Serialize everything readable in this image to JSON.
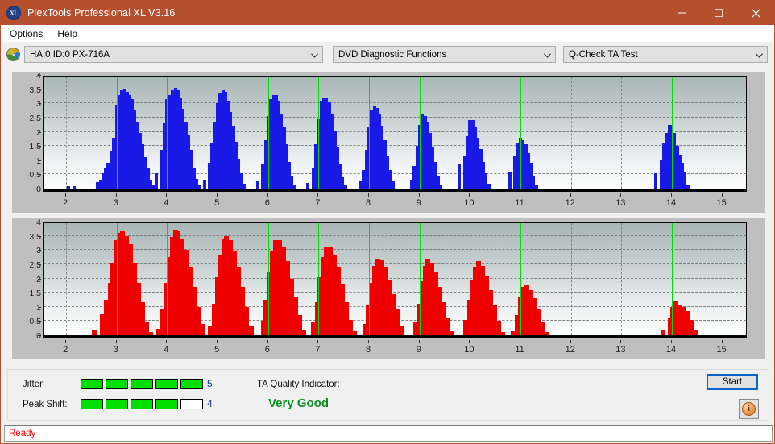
{
  "window": {
    "title": "PlexTools Professional XL V3.16",
    "app_icon": "xl-disc-icon",
    "minimize_label": "minimize-icon",
    "maximize_label": "maximize-icon",
    "close_label": "close-icon",
    "titlebar_color": "#b5502f"
  },
  "menu": {
    "items": [
      {
        "label": "Options"
      },
      {
        "label": "Help"
      }
    ]
  },
  "toolbar": {
    "drive_icon": "disc-icon",
    "drive_select": {
      "value": "HA:0 ID:0  PX-716A",
      "options": [
        "HA:0 ID:0  PX-716A"
      ]
    },
    "function_select": {
      "value": "DVD Diagnostic Functions",
      "options": [
        "DVD Diagnostic Functions"
      ]
    },
    "test_select": {
      "value": "Q-Check TA Test",
      "options": [
        "Q-Check TA Test"
      ]
    }
  },
  "results": {
    "jitter_label": "Jitter:",
    "jitter_value": "5",
    "jitter_segments": [
      true,
      true,
      true,
      true,
      true
    ],
    "peak_shift_label": "Peak Shift:",
    "peak_shift_value": "4",
    "peak_shift_segments": [
      true,
      true,
      true,
      true,
      false
    ],
    "quality_label": "TA Quality Indicator:",
    "quality_value": "Very Good",
    "quality_color": "#0a8f20",
    "start_button": "Start",
    "info_button": "info-icon"
  },
  "status": {
    "text": "Ready",
    "color": "#ff0000"
  },
  "chart_data": [
    {
      "type": "bar",
      "name": "jitter-histogram",
      "title": "",
      "xlabel": "",
      "ylabel": "",
      "color": "#1a1ae6",
      "xlim": [
        1.55,
        15.5
      ],
      "ylim": [
        0,
        4
      ],
      "yticks": [
        0,
        0.5,
        1,
        1.5,
        2,
        2.5,
        3,
        3.5,
        4
      ],
      "ytick_labels": [
        "0",
        "0.5",
        "1",
        "1.5",
        "2",
        "2.5",
        "3",
        "3.5",
        "4"
      ],
      "xticks": [
        2,
        3,
        4,
        5,
        6,
        7,
        8,
        9,
        10,
        11,
        12,
        13,
        14,
        15
      ],
      "xtick_labels": [
        "2",
        "3",
        "4",
        "5",
        "6",
        "7",
        "8",
        "9",
        "10",
        "11",
        "12",
        "13",
        "14",
        "15"
      ],
      "grid": true,
      "markers": [
        3,
        4,
        5,
        6,
        7,
        8,
        9,
        10,
        11,
        14
      ],
      "marker_color": "#00e000",
      "bar_step": 0.105,
      "points": [
        [
          2.05,
          0.09
        ],
        [
          2.16,
          0.09
        ],
        [
          2.62,
          0.22
        ],
        [
          2.73,
          0.55
        ],
        [
          2.83,
          0.9
        ],
        [
          2.89,
          1.3
        ],
        [
          2.94,
          1.78
        ],
        [
          3.0,
          2.3
        ],
        [
          3.05,
          2.47
        ],
        [
          3.1,
          2.8
        ],
        [
          2.68,
          0.3
        ],
        [
          2.78,
          0.72
        ],
        [
          3.0,
          2.95
        ],
        [
          3.05,
          3.3
        ],
        [
          3.1,
          3.45
        ],
        [
          3.16,
          3.5
        ],
        [
          3.21,
          3.4
        ],
        [
          3.26,
          3.3
        ],
        [
          3.31,
          3.15
        ],
        [
          3.36,
          2.75
        ],
        [
          3.42,
          2.35
        ],
        [
          3.47,
          1.95
        ],
        [
          3.52,
          1.55
        ],
        [
          3.57,
          1.1
        ],
        [
          3.63,
          0.7
        ],
        [
          3.68,
          0.3
        ],
        [
          3.73,
          0.12
        ],
        [
          4.0,
          3.15
        ],
        [
          3.79,
          0.55
        ],
        [
          3.89,
          1.35
        ],
        [
          3.95,
          2.3
        ],
        [
          4.05,
          3.3
        ],
        [
          4.1,
          3.45
        ],
        [
          4.16,
          3.55
        ],
        [
          4.21,
          3.45
        ],
        [
          4.26,
          3.2
        ],
        [
          4.31,
          2.8
        ],
        [
          4.37,
          2.35
        ],
        [
          4.42,
          1.9
        ],
        [
          4.47,
          1.35
        ],
        [
          4.53,
          0.75
        ],
        [
          4.58,
          0.35
        ],
        [
          4.63,
          0.12
        ],
        [
          4.74,
          0.3
        ],
        [
          4.84,
          0.9
        ],
        [
          4.89,
          1.6
        ],
        [
          4.95,
          2.35
        ],
        [
          5.0,
          3.0
        ],
        [
          5.05,
          3.35
        ],
        [
          5.11,
          3.45
        ],
        [
          5.16,
          3.4
        ],
        [
          5.21,
          3.1
        ],
        [
          5.26,
          2.7
        ],
        [
          5.32,
          2.2
        ],
        [
          5.37,
          1.65
        ],
        [
          5.42,
          1.05
        ],
        [
          5.47,
          0.55
        ],
        [
          5.53,
          0.18
        ],
        [
          5.79,
          0.25
        ],
        [
          5.89,
          0.85
        ],
        [
          5.95,
          1.7
        ],
        [
          6.0,
          2.55
        ],
        [
          6.05,
          3.15
        ],
        [
          6.11,
          3.3
        ],
        [
          6.16,
          3.3
        ],
        [
          6.21,
          3.1
        ],
        [
          6.26,
          2.65
        ],
        [
          6.32,
          2.15
        ],
        [
          6.37,
          1.55
        ],
        [
          6.42,
          0.95
        ],
        [
          6.47,
          0.45
        ],
        [
          6.53,
          0.15
        ],
        [
          6.79,
          0.2
        ],
        [
          6.89,
          0.75
        ],
        [
          6.95,
          1.55
        ],
        [
          7.0,
          2.45
        ],
        [
          7.05,
          3.1
        ],
        [
          7.11,
          3.2
        ],
        [
          7.16,
          3.2
        ],
        [
          7.21,
          3.05
        ],
        [
          7.26,
          2.6
        ],
        [
          7.32,
          2.05
        ],
        [
          7.37,
          1.45
        ],
        [
          7.42,
          0.85
        ],
        [
          7.47,
          0.4
        ],
        [
          7.53,
          0.12
        ],
        [
          7.84,
          0.25
        ],
        [
          7.89,
          0.65
        ],
        [
          7.95,
          1.35
        ],
        [
          8.0,
          2.15
        ],
        [
          8.05,
          2.75
        ],
        [
          8.11,
          2.9
        ],
        [
          8.16,
          2.85
        ],
        [
          8.21,
          2.6
        ],
        [
          8.26,
          2.2
        ],
        [
          8.32,
          1.7
        ],
        [
          8.37,
          1.15
        ],
        [
          8.42,
          0.65
        ],
        [
          8.47,
          0.25
        ],
        [
          8.84,
          0.3
        ],
        [
          8.89,
          0.8
        ],
        [
          8.95,
          1.5
        ],
        [
          9.0,
          2.25
        ],
        [
          9.05,
          2.6
        ],
        [
          9.11,
          2.55
        ],
        [
          9.16,
          2.35
        ],
        [
          9.21,
          1.95
        ],
        [
          9.26,
          1.45
        ],
        [
          9.32,
          0.95
        ],
        [
          9.37,
          0.45
        ],
        [
          9.42,
          0.15
        ],
        [
          9.79,
          0.85
        ],
        [
          9.89,
          1.15
        ],
        [
          9.95,
          1.85
        ],
        [
          10.0,
          2.4
        ],
        [
          10.05,
          2.4
        ],
        [
          10.11,
          2.15
        ],
        [
          10.16,
          1.8
        ],
        [
          10.21,
          1.4
        ],
        [
          10.26,
          0.95
        ],
        [
          10.32,
          0.55
        ],
        [
          10.37,
          0.18
        ],
        [
          10.79,
          0.6
        ],
        [
          10.89,
          1.15
        ],
        [
          10.95,
          1.6
        ],
        [
          11.0,
          1.8
        ],
        [
          11.05,
          1.7
        ],
        [
          11.11,
          1.55
        ],
        [
          11.16,
          1.25
        ],
        [
          11.21,
          0.9
        ],
        [
          11.26,
          0.45
        ],
        [
          11.32,
          0.12
        ],
        [
          13.68,
          0.55
        ],
        [
          13.79,
          1.0
        ],
        [
          13.84,
          1.6
        ],
        [
          13.89,
          1.95
        ],
        [
          13.95,
          2.25
        ],
        [
          14.0,
          2.25
        ],
        [
          14.05,
          1.95
        ],
        [
          14.11,
          1.5
        ],
        [
          14.16,
          1.2
        ],
        [
          14.21,
          0.9
        ],
        [
          14.26,
          0.6
        ],
        [
          14.32,
          0.12
        ]
      ]
    },
    {
      "type": "bar",
      "name": "peak-shift-histogram",
      "title": "",
      "xlabel": "",
      "ylabel": "",
      "color": "#ee0000",
      "xlim": [
        1.55,
        15.5
      ],
      "ylim": [
        0,
        4
      ],
      "yticks": [
        0,
        0.5,
        1,
        1.5,
        2,
        2.5,
        3,
        3.5,
        4
      ],
      "ytick_labels": [
        "0",
        "0.5",
        "1",
        "1.5",
        "2",
        "2.5",
        "3",
        "3.5",
        "4"
      ],
      "xticks": [
        2,
        3,
        4,
        5,
        6,
        7,
        8,
        9,
        10,
        11,
        12,
        13,
        14,
        15
      ],
      "xtick_labels": [
        "2",
        "3",
        "4",
        "5",
        "6",
        "7",
        "8",
        "9",
        "10",
        "11",
        "12",
        "13",
        "14",
        "15"
      ],
      "grid": true,
      "markers": [
        3,
        4,
        5,
        6,
        7,
        8,
        9,
        10,
        11,
        14
      ],
      "marker_color": "#00e000",
      "bar_step": 0.155,
      "points": [
        [
          2.55,
          0.18
        ],
        [
          2.71,
          0.75
        ],
        [
          2.79,
          1.25
        ],
        [
          2.87,
          1.85
        ],
        [
          2.93,
          2.55
        ],
        [
          3.0,
          3.35
        ],
        [
          3.06,
          3.6
        ],
        [
          3.12,
          3.65
        ],
        [
          3.2,
          3.5
        ],
        [
          3.28,
          3.2
        ],
        [
          3.36,
          2.55
        ],
        [
          3.44,
          1.85
        ],
        [
          3.52,
          1.15
        ],
        [
          3.6,
          0.45
        ],
        [
          3.68,
          0.12
        ],
        [
          3.84,
          0.22
        ],
        [
          3.92,
          0.95
        ],
        [
          3.98,
          1.85
        ],
        [
          4.04,
          2.75
        ],
        [
          4.1,
          3.45
        ],
        [
          4.16,
          3.7
        ],
        [
          4.22,
          3.65
        ],
        [
          4.3,
          3.4
        ],
        [
          4.38,
          3.0
        ],
        [
          4.46,
          2.4
        ],
        [
          4.54,
          1.7
        ],
        [
          4.62,
          1.0
        ],
        [
          4.7,
          0.4
        ],
        [
          4.86,
          0.35
        ],
        [
          4.93,
          1.1
        ],
        [
          5.0,
          2.05
        ],
        [
          5.06,
          2.85
        ],
        [
          5.12,
          3.4
        ],
        [
          5.18,
          3.5
        ],
        [
          5.26,
          3.35
        ],
        [
          5.34,
          2.95
        ],
        [
          5.42,
          2.4
        ],
        [
          5.5,
          1.7
        ],
        [
          5.58,
          1.0
        ],
        [
          5.66,
          0.35
        ],
        [
          5.9,
          0.5
        ],
        [
          5.96,
          1.25
        ],
        [
          6.02,
          2.2
        ],
        [
          6.08,
          2.95
        ],
        [
          6.14,
          3.35
        ],
        [
          6.22,
          3.35
        ],
        [
          6.3,
          3.1
        ],
        [
          6.38,
          2.6
        ],
        [
          6.46,
          2.0
        ],
        [
          6.54,
          1.35
        ],
        [
          6.62,
          0.7
        ],
        [
          6.7,
          0.2
        ],
        [
          6.9,
          0.45
        ],
        [
          6.97,
          1.15
        ],
        [
          7.03,
          2.05
        ],
        [
          7.09,
          2.75
        ],
        [
          7.15,
          3.1
        ],
        [
          7.23,
          3.1
        ],
        [
          7.31,
          2.85
        ],
        [
          7.39,
          2.4
        ],
        [
          7.47,
          1.8
        ],
        [
          7.55,
          1.15
        ],
        [
          7.63,
          0.55
        ],
        [
          7.71,
          0.15
        ],
        [
          7.92,
          0.4
        ],
        [
          7.99,
          1.05
        ],
        [
          8.05,
          1.85
        ],
        [
          8.11,
          2.45
        ],
        [
          8.17,
          2.7
        ],
        [
          8.25,
          2.65
        ],
        [
          8.33,
          2.4
        ],
        [
          8.41,
          1.95
        ],
        [
          8.49,
          1.45
        ],
        [
          8.57,
          0.9
        ],
        [
          8.65,
          0.35
        ],
        [
          8.92,
          0.45
        ],
        [
          8.99,
          1.1
        ],
        [
          9.05,
          1.9
        ],
        [
          9.11,
          2.45
        ],
        [
          9.17,
          2.7
        ],
        [
          9.25,
          2.55
        ],
        [
          9.33,
          2.2
        ],
        [
          9.41,
          1.7
        ],
        [
          9.49,
          1.15
        ],
        [
          9.57,
          0.6
        ],
        [
          9.65,
          0.15
        ],
        [
          9.92,
          0.55
        ],
        [
          9.99,
          1.25
        ],
        [
          10.05,
          1.95
        ],
        [
          10.11,
          2.4
        ],
        [
          10.17,
          2.6
        ],
        [
          10.25,
          2.45
        ],
        [
          10.33,
          2.1
        ],
        [
          10.41,
          1.6
        ],
        [
          10.49,
          1.05
        ],
        [
          10.57,
          0.5
        ],
        [
          10.65,
          0.12
        ],
        [
          10.86,
          0.15
        ],
        [
          10.94,
          0.7
        ],
        [
          11.0,
          1.35
        ],
        [
          11.06,
          1.7
        ],
        [
          11.12,
          1.75
        ],
        [
          11.2,
          1.6
        ],
        [
          11.28,
          1.3
        ],
        [
          11.36,
          0.9
        ],
        [
          11.44,
          0.45
        ],
        [
          11.52,
          0.12
        ],
        [
          13.82,
          0.18
        ],
        [
          13.96,
          0.6
        ],
        [
          14.02,
          1.0
        ],
        [
          14.08,
          1.2
        ],
        [
          14.16,
          1.05
        ],
        [
          14.24,
          1.0
        ],
        [
          14.32,
          0.85
        ],
        [
          14.4,
          0.55
        ],
        [
          14.48,
          0.18
        ]
      ]
    }
  ]
}
